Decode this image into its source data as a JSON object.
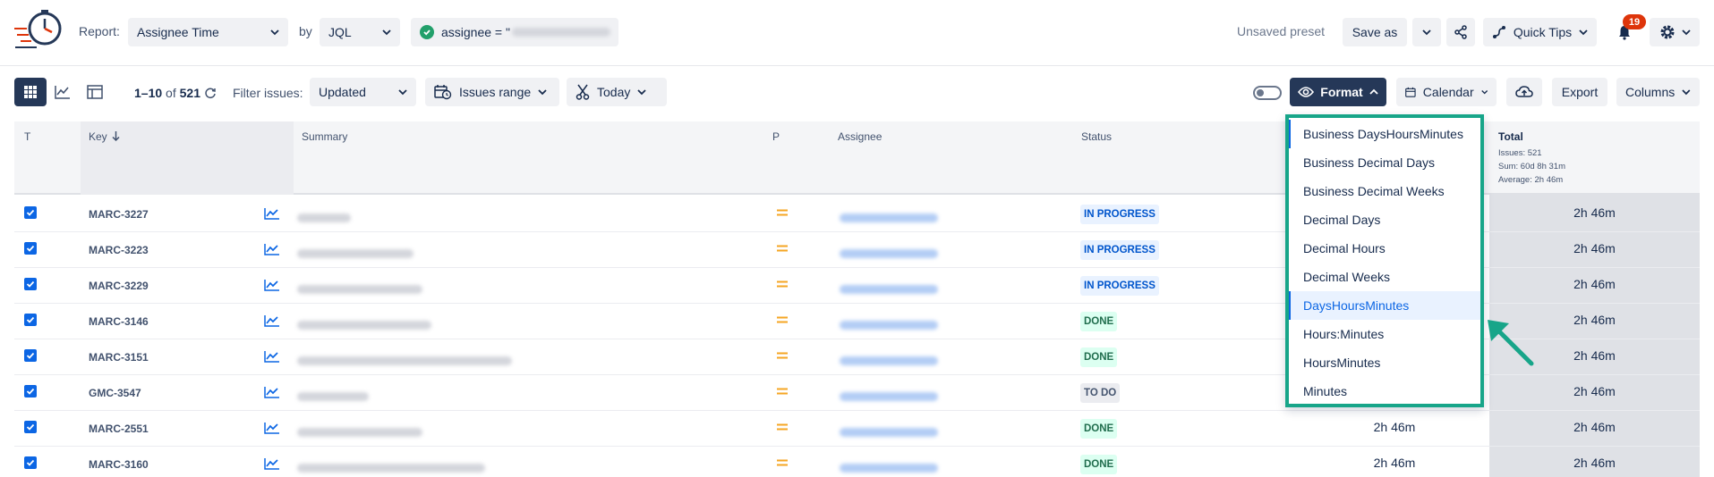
{
  "header": {
    "report_label": "Report:",
    "report_value": "Assignee Time",
    "by_label": "by",
    "by_value": "JQL",
    "jql_prefix": "assignee = \"",
    "unsaved_preset": "Unsaved preset",
    "save_as": "Save as",
    "quick_tips": "Quick Tips",
    "notification_count": "19"
  },
  "toolbar": {
    "range_start": "1–10",
    "of_label": "of",
    "total_count": "521",
    "filter_label": "Filter issues:",
    "filter_value": "Updated",
    "issues_range": "Issues range",
    "today": "Today",
    "format": "Format",
    "calendar": "Calendar",
    "export": "Export",
    "columns": "Columns"
  },
  "table": {
    "headers": {
      "t": "T",
      "key": "Key",
      "summary": "Summary",
      "p": "P",
      "assignee": "Assignee",
      "status": "Status",
      "total": "Total"
    },
    "total_stats": {
      "issues": "Issues: 521",
      "sum": "Sum: 60d 8h 31m",
      "average": "Average: 2h 46m"
    },
    "rows": [
      {
        "key": "MARC-3227",
        "status": "IN PROGRESS",
        "status_type": "progress",
        "total": "2h 46m",
        "mid": ""
      },
      {
        "key": "MARC-3223",
        "status": "IN PROGRESS",
        "status_type": "progress",
        "total": "2h 46m",
        "mid": ""
      },
      {
        "key": "MARC-3229",
        "status": "IN PROGRESS",
        "status_type": "progress",
        "total": "2h 46m",
        "mid": ""
      },
      {
        "key": "MARC-3146",
        "status": "DONE",
        "status_type": "done",
        "total": "2h 46m",
        "mid": ""
      },
      {
        "key": "MARC-3151",
        "status": "DONE",
        "status_type": "done",
        "total": "2h 46m",
        "mid": ""
      },
      {
        "key": "GMC-3547",
        "status": "TO DO",
        "status_type": "todo",
        "total": "2h 46m",
        "mid": ""
      },
      {
        "key": "MARC-2551",
        "status": "DONE",
        "status_type": "done",
        "total": "2h 46m",
        "mid": "2h 46m"
      },
      {
        "key": "MARC-3160",
        "status": "DONE",
        "status_type": "done",
        "total": "2h 46m",
        "mid": "2h 46m"
      }
    ]
  },
  "format_menu": {
    "items": [
      "Business DaysHoursMinutes",
      "Business Decimal Days",
      "Business Decimal Weeks",
      "Decimal Days",
      "Decimal Hours",
      "Decimal Weeks",
      "DaysHoursMinutes",
      "Hours:Minutes",
      "HoursMinutes",
      "Minutes"
    ],
    "selected_index": 6
  },
  "colors": {
    "accent_dark": "#253858",
    "highlight": "#17a589",
    "link": "#0c66e4",
    "priority": "#f5a623"
  }
}
